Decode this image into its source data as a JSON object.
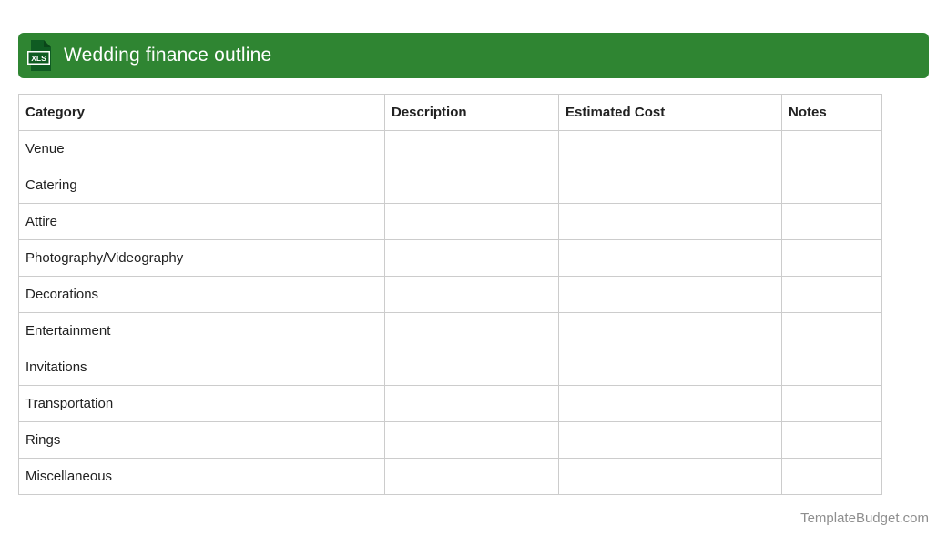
{
  "header": {
    "title": "Wedding finance outline",
    "icon_label": "XLS"
  },
  "colors": {
    "header_green": "#2F8532",
    "icon_dark_green": "#0F5B22",
    "icon_fold_green": "#0A4519",
    "table_border": "#CCCCCC",
    "table_text": "#212121",
    "footer_text": "#8E8E8E"
  },
  "table": {
    "columns": [
      "Category",
      "Description",
      "Estimated Cost",
      "Notes"
    ],
    "rows": [
      [
        "Venue",
        "",
        "",
        ""
      ],
      [
        "Catering",
        "",
        "",
        ""
      ],
      [
        "Attire",
        "",
        "",
        ""
      ],
      [
        "Photography/Videography",
        "",
        "",
        ""
      ],
      [
        "Decorations",
        "",
        "",
        ""
      ],
      [
        "Entertainment",
        "",
        "",
        ""
      ],
      [
        "Invitations",
        "",
        "",
        ""
      ],
      [
        "Transportation",
        "",
        "",
        ""
      ],
      [
        "Rings",
        "",
        "",
        ""
      ],
      [
        "Miscellaneous",
        "",
        "",
        ""
      ]
    ]
  },
  "footer": {
    "site": "TemplateBudget.com"
  }
}
